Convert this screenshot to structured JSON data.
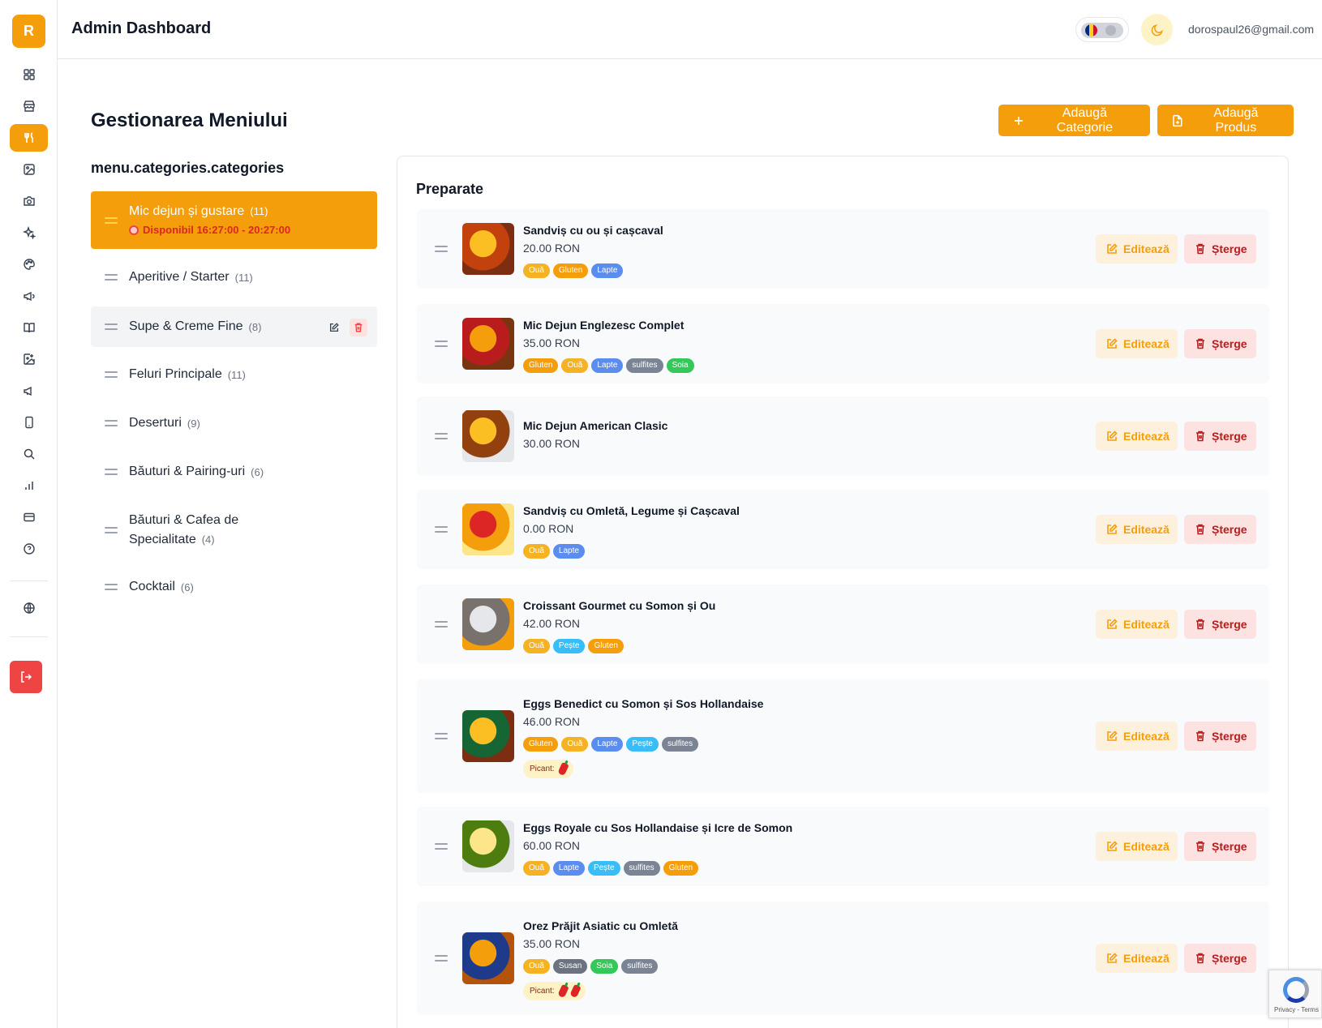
{
  "header": {
    "logo": "R",
    "title": "Admin Dashboard",
    "user_email": "dorospaul26@gmail.com",
    "flag_colors": [
      "#002B7F",
      "#FCD116",
      "#CE1126"
    ]
  },
  "page": {
    "title": "Gestionarea Meniului",
    "add_category": "Adaugă Categorie",
    "add_product": "Adaugă Produs"
  },
  "sidebar": {
    "icons": [
      "dashboard-icon",
      "store-icon",
      "utensils-icon",
      "image-icon",
      "camera-icon",
      "sparkles-icon",
      "palette-icon",
      "megaphone-icon",
      "book-icon",
      "image-plus-icon",
      "megaphone-2-icon",
      "smartphone-icon",
      "search-icon",
      "bar-chart-icon",
      "credit-card-icon",
      "help-icon",
      "globe-icon",
      "logout-icon"
    ]
  },
  "categories": {
    "heading": "menu.categories.categories",
    "items": [
      {
        "name": "Mic dejun și gustare",
        "count": "(11)",
        "availability": "Disponibil 16:27:00 - 20:27:00"
      },
      {
        "name": "Aperitive / Starter",
        "count": "(11)"
      },
      {
        "name": "Supe & Creme Fine",
        "count": "(8)"
      },
      {
        "name": "Feluri Principale",
        "count": "(11)"
      },
      {
        "name": "Deserturi",
        "count": "(9)"
      },
      {
        "name": "Băuturi & Pairing-uri",
        "count": "(6)"
      },
      {
        "name": "Băuturi & Cafea de Specialitate",
        "count": "(4)"
      },
      {
        "name": "Cocktail",
        "count": "(6)"
      }
    ]
  },
  "products": {
    "title": "Preparate",
    "edit_label": "Editează",
    "delete_label": "Șterge",
    "spicy_label": "Picant:",
    "tag_colors": {
      "Ouă": "#f5b324",
      "Gluten": "#f59e0b",
      "Lapte": "#5b8def",
      "sulfites": "#7b8494",
      "Soia": "#34c759",
      "Pește": "#38bdf8",
      "Susan": "#6b7280"
    },
    "items": [
      {
        "name": "Sandviș cu ou și cașcaval",
        "price": "20.00 RON",
        "tags": [
          "Ouă",
          "Gluten",
          "Lapte"
        ],
        "spicy": 0
      },
      {
        "name": "Mic Dejun Englezesc Complet",
        "price": "35.00 RON",
        "tags": [
          "Gluten",
          "Ouă",
          "Lapte",
          "sulfites",
          "Soia"
        ],
        "spicy": 0
      },
      {
        "name": "Mic Dejun American Clasic",
        "price": "30.00 RON",
        "tags": [],
        "spicy": 0
      },
      {
        "name": "Sandviș cu Omletă, Legume și Cașcaval",
        "price": "0.00 RON",
        "tags": [
          "Ouă",
          "Lapte"
        ],
        "spicy": 0
      },
      {
        "name": "Croissant Gourmet cu Somon și Ou",
        "price": "42.00 RON",
        "tags": [
          "Ouă",
          "Pește",
          "Gluten"
        ],
        "spicy": 0
      },
      {
        "name": "Eggs Benedict cu Somon și Sos Hollandaise",
        "price": "46.00 RON",
        "tags": [
          "Gluten",
          "Ouă",
          "Lapte",
          "Pește",
          "sulfites"
        ],
        "spicy": 1
      },
      {
        "name": "Eggs Royale cu Sos Hollandaise și Icre de Somon",
        "price": "60.00 RON",
        "tags": [
          "Ouă",
          "Lapte",
          "Pește",
          "sulfites",
          "Gluten"
        ],
        "spicy": 0
      },
      {
        "name": "Orez Prăjit Asiatic cu Omletă",
        "price": "35.00 RON",
        "tags": [
          "Ouă",
          "Susan",
          "Soia",
          "sulfites"
        ],
        "spicy": 2
      }
    ]
  },
  "recaptcha": {
    "text": "Privacy - Terms"
  }
}
